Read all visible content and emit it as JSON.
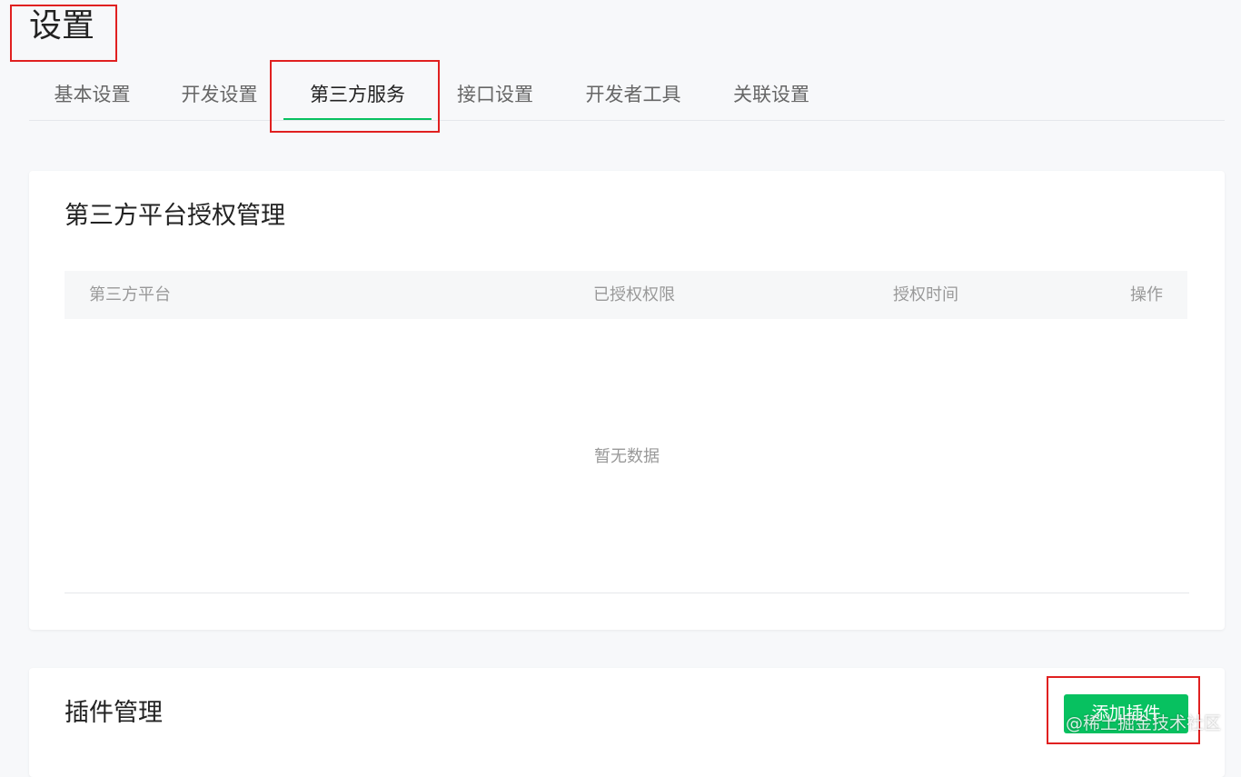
{
  "page": {
    "title": "设置"
  },
  "tabs": [
    {
      "label": "基本设置",
      "active": false
    },
    {
      "label": "开发设置",
      "active": false
    },
    {
      "label": "第三方服务",
      "active": true
    },
    {
      "label": "接口设置",
      "active": false
    },
    {
      "label": "开发者工具",
      "active": false
    },
    {
      "label": "关联设置",
      "active": false
    }
  ],
  "auth_section": {
    "title": "第三方平台授权管理",
    "columns": [
      "第三方平台",
      "已授权权限",
      "授权时间",
      "操作"
    ],
    "empty_text": "暂无数据"
  },
  "plugin_section": {
    "title": "插件管理",
    "add_button": "添加插件"
  },
  "watermark": "@稀土掘金技术社区",
  "colors": {
    "accent": "#07c160",
    "annotation": "#e02020",
    "background": "#f7f8fa"
  }
}
